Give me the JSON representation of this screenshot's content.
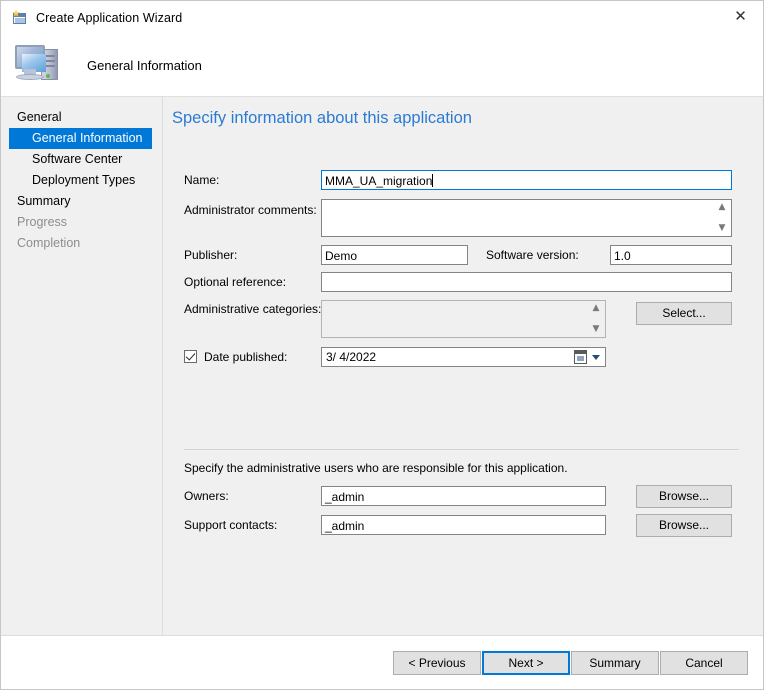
{
  "window": {
    "title": "Create Application Wizard",
    "title_icon": "new-window-icon",
    "close_label": "✕"
  },
  "header": {
    "title": "General Information",
    "icon": "computer-icon"
  },
  "sidebar": {
    "items": [
      {
        "label": "General",
        "level": "group",
        "state": "normal"
      },
      {
        "label": "General Information",
        "level": "child",
        "state": "selected"
      },
      {
        "label": "Software Center",
        "level": "child",
        "state": "normal"
      },
      {
        "label": "Deployment Types",
        "level": "child",
        "state": "normal"
      },
      {
        "label": "Summary",
        "level": "group",
        "state": "normal"
      },
      {
        "label": "Progress",
        "level": "group",
        "state": "disabled"
      },
      {
        "label": "Completion",
        "level": "group",
        "state": "disabled"
      }
    ]
  },
  "content": {
    "heading": "Specify information about this application",
    "fields": {
      "name_label": "Name:",
      "name_value": "MMA_UA_migration",
      "admin_comments_label": "Administrator comments:",
      "admin_comments_value": "",
      "publisher_label": "Publisher:",
      "publisher_value": "Demo",
      "software_version_label": "Software version:",
      "software_version_value": "1.0",
      "optional_reference_label": "Optional reference:",
      "optional_reference_value": "",
      "admin_categories_label": "Administrative categories:",
      "admin_categories_value": "",
      "select_button": "Select...",
      "date_published_label": "Date published:",
      "date_published_checked": true,
      "date_published_value": "3/  4/2022"
    },
    "admin_section": {
      "note": "Specify the administrative users who are responsible for this application.",
      "owners_label": "Owners:",
      "owners_value": "_admin",
      "owners_browse": "Browse...",
      "support_label": "Support contacts:",
      "support_value": "_admin",
      "support_browse": "Browse..."
    }
  },
  "footer": {
    "previous": "< Previous",
    "next": "Next >",
    "summary": "Summary",
    "cancel": "Cancel",
    "default_button": "next"
  },
  "colors": {
    "accent": "#0078d7",
    "heading": "#2a7bd4",
    "panel": "#f0f0f0",
    "button_face": "#e1e1e1"
  }
}
